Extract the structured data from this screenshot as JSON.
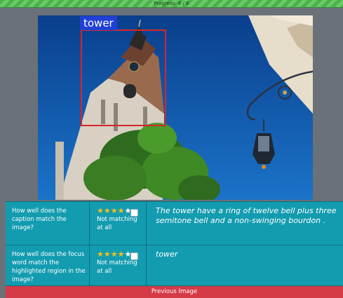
{
  "progress": {
    "label": "Progress: 6 / 6",
    "fraction": 1.0
  },
  "image": {
    "region_label": "tower",
    "bbox_color": "#d8252a",
    "label_bg": "#2140d6"
  },
  "questions": [
    {
      "question": "How well does the caption match the image?",
      "stars_filled": 4,
      "stars_total": 5,
      "not_matching_label": "Not matching at all",
      "answer_text": "The tower have a ring of twelve bell plus three semitone bell and a non-swinging bourdon ."
    },
    {
      "question": "How well does the focus word match the highlighted region in the image?",
      "stars_filled": 4,
      "stars_total": 5,
      "not_matching_label": "Not matching at all",
      "answer_text": "tower"
    }
  ],
  "footer": {
    "previous_label": "Previous Image"
  },
  "colors": {
    "progress": "#49b34a",
    "table": "#139cb0",
    "button": "#d53a47",
    "star": "#f7c01c"
  }
}
